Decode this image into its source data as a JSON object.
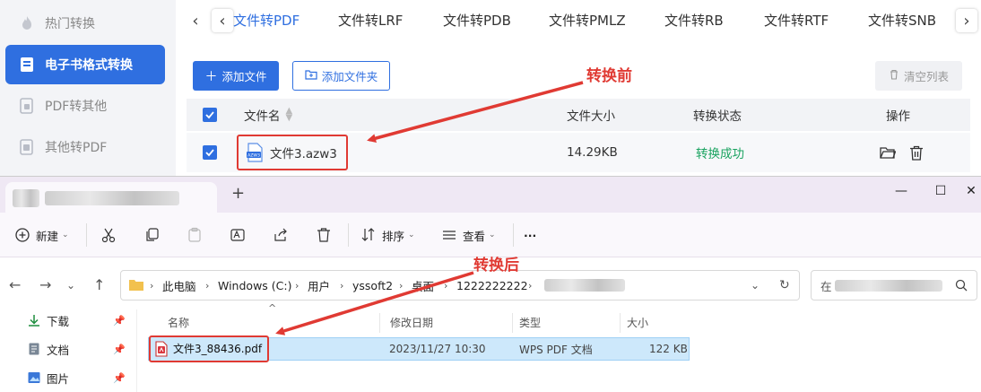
{
  "sidebar": {
    "items": [
      {
        "label": "热门转换",
        "icon": "flame-icon"
      },
      {
        "label": "电子书格式转换",
        "icon": "ebook-icon",
        "active": true
      },
      {
        "label": "PDF转其他",
        "icon": "pdf-convert-icon"
      },
      {
        "label": "其他转PDF",
        "icon": "convert-to-pdf-icon"
      }
    ]
  },
  "tabs": {
    "prev": "‹",
    "next": "›",
    "items": [
      "文件转PDF",
      "文件转LRF",
      "文件转PDB",
      "文件转PMLZ",
      "文件转RB",
      "文件转RTF",
      "文件转SNB"
    ]
  },
  "toolbar": {
    "add_file": "添加文件",
    "add_folder": "添加文件夹",
    "clear_list": "清空列表"
  },
  "table": {
    "headers": {
      "name": "文件名",
      "size": "文件大小",
      "status": "转换状态",
      "action": "操作"
    },
    "rows": [
      {
        "name": "文件3.azw3",
        "size": "14.29KB",
        "status": "转换成功"
      }
    ]
  },
  "annotations": {
    "before": "转换前",
    "after": "转换后"
  },
  "explorer": {
    "toolbar": {
      "new": "新建",
      "sort": "排序",
      "view": "查看",
      "more": "···"
    },
    "breadcrumb": [
      "此电脑",
      "Windows (C:)",
      "用户",
      "yssoft2",
      "桌面",
      "1222222222"
    ],
    "search_prefix": "在",
    "nav_items": [
      {
        "label": "下载",
        "icon": "download-icon"
      },
      {
        "label": "文档",
        "icon": "document-icon"
      },
      {
        "label": "图片",
        "icon": "picture-icon"
      }
    ],
    "columns": {
      "name": "名称",
      "modified": "修改日期",
      "type": "类型",
      "size": "大小"
    },
    "files": [
      {
        "name": "文件3_88436.pdf",
        "modified": "2023/11/27 10:30",
        "type": "WPS PDF 文档",
        "size": "122 KB"
      }
    ]
  },
  "colors": {
    "accent": "#2f6fe0",
    "success": "#1aa360",
    "annotation": "#e03a33"
  }
}
